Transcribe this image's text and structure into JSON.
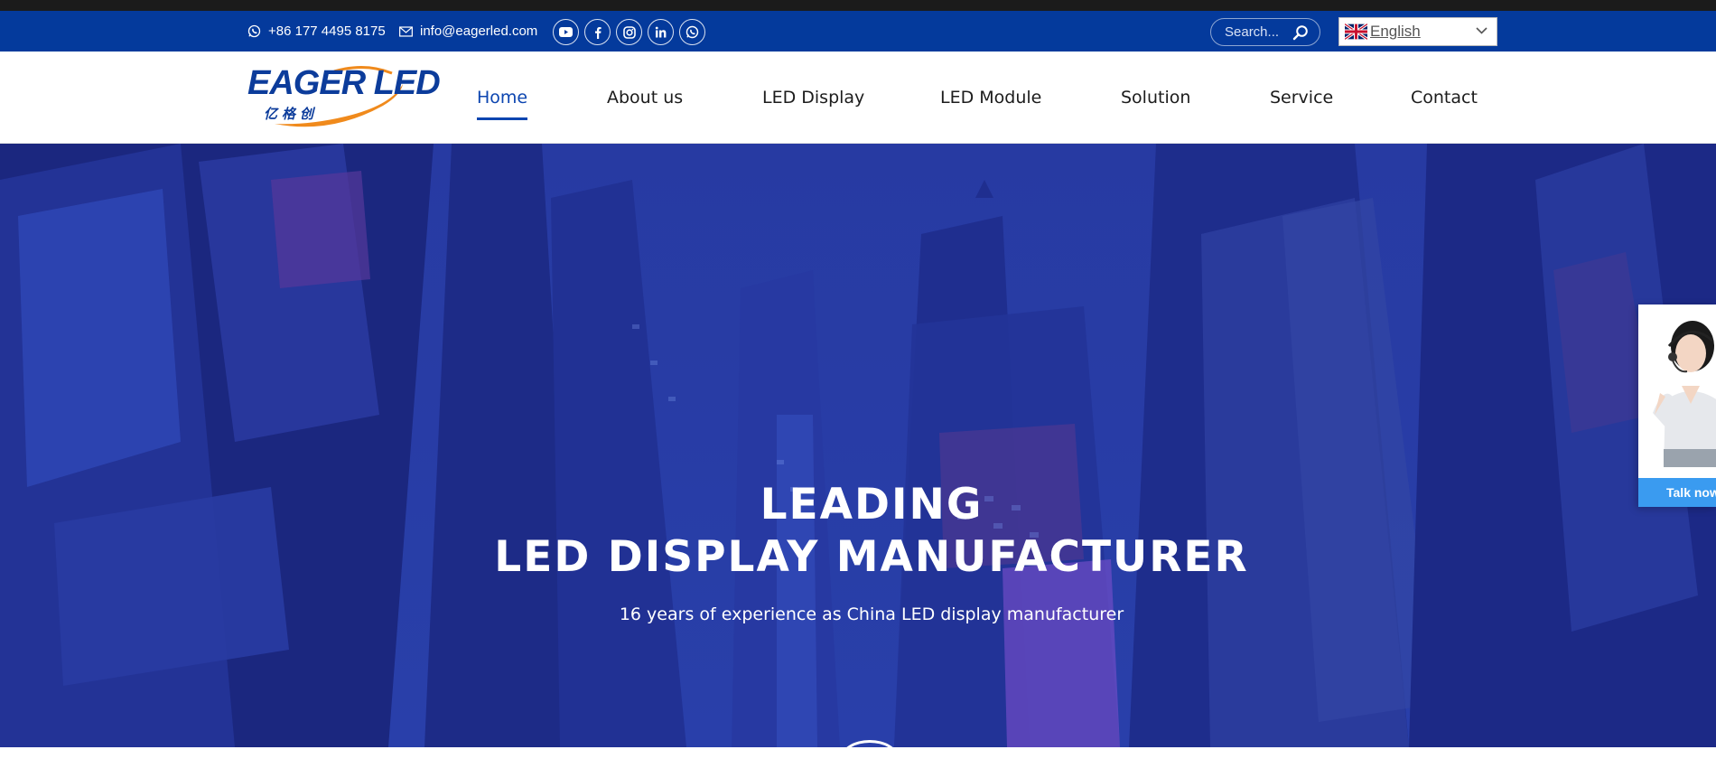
{
  "topbar": {
    "phone": "+86 177 4495 8175",
    "email": "info@eagerled.com",
    "socials": [
      "youtube-icon",
      "facebook-icon",
      "instagram-icon",
      "linkedin-icon",
      "whatsapp-icon"
    ],
    "search_placeholder": "Search...",
    "language": "English"
  },
  "logo": {
    "brand": "EAGER LED",
    "chinese": "亿格创"
  },
  "nav": {
    "items": [
      "Home",
      "About us",
      "LED Display",
      "LED Module",
      "Solution",
      "Service",
      "Contact"
    ],
    "active": "Home"
  },
  "hero": {
    "title_line1": "LEADING",
    "title_line2": "LED DISPLAY MANUFACTURER",
    "subtitle": "16 years of experience as China LED display manufacturer"
  },
  "chat": {
    "button": "Talk now"
  },
  "colors": {
    "topbar": "#043a9c",
    "accent": "#0c45b0",
    "chat_button": "#3a9bf0",
    "hero_overlay": "#1f3196"
  }
}
